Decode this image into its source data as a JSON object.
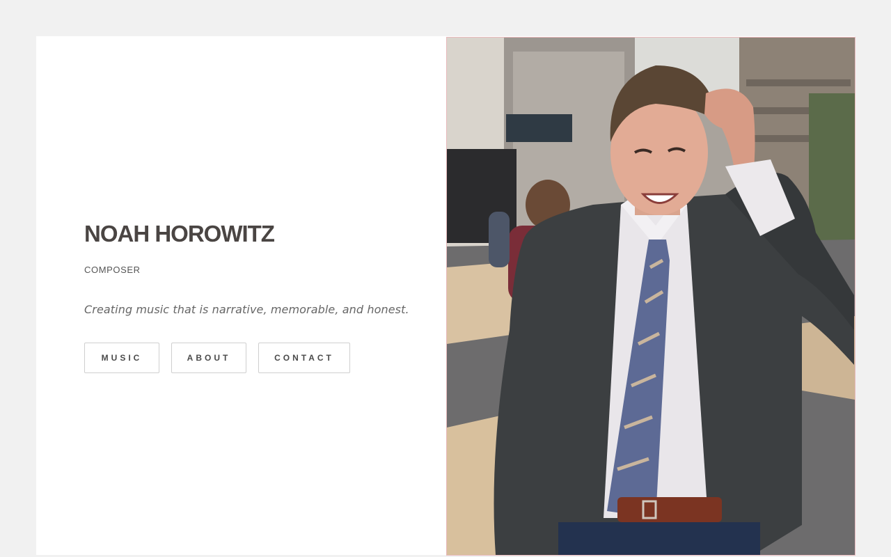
{
  "hero": {
    "name": "NOAH HOROWITZ",
    "role": "COMPOSER",
    "tagline": "Creating music that is narrative, memorable, and honest."
  },
  "nav": {
    "buttons": [
      {
        "label": "MUSIC"
      },
      {
        "label": "ABOUT"
      },
      {
        "label": "CONTACT"
      }
    ]
  },
  "colors": {
    "page_background": "#f1f1f1",
    "card_background": "#ffffff",
    "heading": "#4a4543",
    "button_border": "#cfcfcf"
  }
}
